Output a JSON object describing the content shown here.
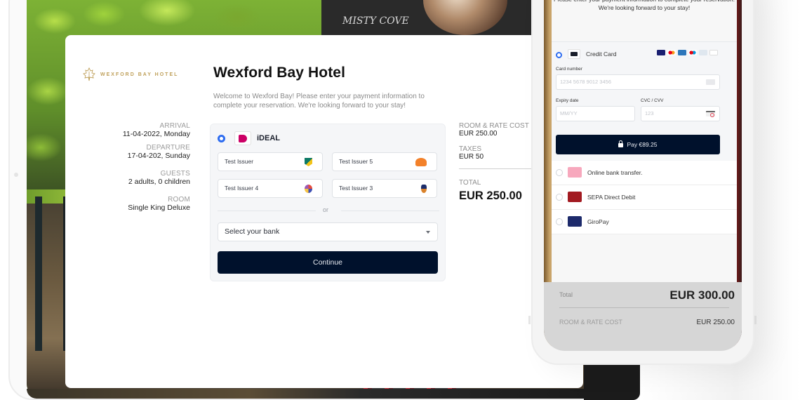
{
  "desktop": {
    "brand_name": "WEXFORD BAY HOTEL",
    "background_sign": "MISTY COVE",
    "title": "Wexford Bay Hotel",
    "intro": "Welcome to Wexford Bay! Please enter your payment information to complete your reservation. We're looking forward to your stay!",
    "booking": {
      "arrival_label": "ARRIVAL",
      "arrival_value": "11-04-2022, Monday",
      "departure_label": "DEPARTURE",
      "departure_value": "17-04-202, Sunday",
      "guests_label": "GUESTS",
      "guests_value": "2 adults, 0 children",
      "room_label": "ROOM",
      "room_value": "Single King Deluxe"
    },
    "payment": {
      "method_label": "iDEAL",
      "method_icon": "ideal-logo",
      "selected": true,
      "issuers": [
        {
          "label": "Test Issuer",
          "icon": "abn-amro-icon"
        },
        {
          "label": "Test Issuer 5",
          "icon": "ing-lion-icon"
        },
        {
          "label": "Test Issuer 4",
          "icon": "wheel-icon"
        },
        {
          "label": "Test Issuer 3",
          "icon": "figure-icon"
        }
      ],
      "or_text": "or",
      "select_bank_placeholder": "Select your bank",
      "continue_label": "Continue"
    },
    "summary": {
      "room_rate_label": "ROOM & RATE COST",
      "room_rate_value": "EUR 250.00",
      "taxes_label": "TAXES",
      "taxes_value": "EUR 50",
      "total_label": "TOTAL",
      "total_value": "EUR 250.00"
    }
  },
  "mobile": {
    "intro": "Please enter your payment information to complete your reservation. We're looking forward to your stay!",
    "credit_card": {
      "label": "Credit Card",
      "selected": true,
      "brands": [
        "visa",
        "mastercard",
        "amex",
        "maestro",
        "cartes-bancaires",
        "discover"
      ],
      "card_number_label": "Card number",
      "card_number_placeholder": "1234 5678 9012 3456",
      "expiry_label": "Expiry date",
      "expiry_placeholder": "MM/YY",
      "cvc_label": "CVC / CVV",
      "cvc_placeholder": "123",
      "pay_label": "Pay €89.25"
    },
    "methods": [
      {
        "label": "Online bank transfer.",
        "icon": "sofort-logo"
      },
      {
        "label": "SEPA Direct Debit",
        "icon": "sepa-logo"
      },
      {
        "label": "GiroPay",
        "icon": "giropay-logo"
      }
    ],
    "total_label": "Total",
    "total_value": "EUR 300.00",
    "room_rate_label": "ROOM & RATE COST",
    "room_rate_value": "EUR 250.00"
  }
}
